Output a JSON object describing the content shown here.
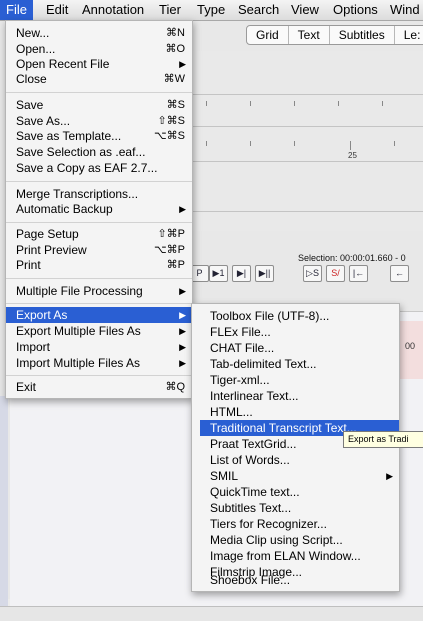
{
  "menubar": {
    "items": [
      "File",
      "Edit",
      "Annotation",
      "Tier",
      "Type",
      "Search",
      "View",
      "Options",
      "Wind"
    ]
  },
  "background": {
    "tabs": [
      "Grid",
      "Text",
      "Subtitles",
      "Le:"
    ],
    "ruler_label": "25",
    "selection_text": "Selection: 00:00:01.660 - 0",
    "time_text": "00",
    "player_buttons": [
      "P",
      "▶1",
      "▶|",
      "▶||",
      "▷S",
      "S/",
      "|←",
      "←"
    ]
  },
  "file_menu": {
    "items": [
      {
        "label": "New...",
        "shortcut": "⌘N"
      },
      {
        "label": "Open...",
        "shortcut": "⌘O"
      },
      {
        "label": "Open Recent File",
        "submenu": true
      },
      {
        "label": "Close",
        "shortcut": "⌘W"
      },
      {
        "label": "Save",
        "shortcut": "⌘S"
      },
      {
        "label": "Save As...",
        "shortcut": "⇧⌘S"
      },
      {
        "label": "Save as Template...",
        "shortcut": "⌥⌘S"
      },
      {
        "label": "Save Selection as .eaf..."
      },
      {
        "label": "Save a Copy as EAF 2.7..."
      },
      {
        "label": "Merge Transcriptions..."
      },
      {
        "label": "Automatic Backup",
        "submenu": true
      },
      {
        "label": "Page Setup",
        "shortcut": "⇧⌘P"
      },
      {
        "label": "Print Preview",
        "shortcut": "⌥⌘P"
      },
      {
        "label": "Print",
        "shortcut": "⌘P"
      },
      {
        "label": "Multiple File Processing",
        "submenu": true
      },
      {
        "label": "Export As",
        "submenu": true,
        "highlighted": true
      },
      {
        "label": "Export Multiple Files As",
        "submenu": true
      },
      {
        "label": "Import",
        "submenu": true
      },
      {
        "label": "Import Multiple Files As",
        "submenu": true
      },
      {
        "label": "Exit",
        "shortcut": "⌘Q"
      }
    ]
  },
  "export_submenu": {
    "items": [
      {
        "label": "Toolbox File (UTF-8)..."
      },
      {
        "label": "FLEx File..."
      },
      {
        "label": "CHAT File..."
      },
      {
        "label": "Tab-delimited Text..."
      },
      {
        "label": "Tiger-xml..."
      },
      {
        "label": "Interlinear Text..."
      },
      {
        "label": "HTML..."
      },
      {
        "label": "Traditional Transcript Text...",
        "highlighted": true
      },
      {
        "label": "Praat TextGrid..."
      },
      {
        "label": "List of Words..."
      },
      {
        "label": "SMIL",
        "submenu": true
      },
      {
        "label": "QuickTime text..."
      },
      {
        "label": "Subtitles Text..."
      },
      {
        "label": "Tiers for Recognizer..."
      },
      {
        "label": "Media Clip using Script..."
      },
      {
        "label": "Image from ELAN Window..."
      },
      {
        "label": "Filmstrip Image..."
      },
      {
        "label": "Shoebox File..."
      }
    ]
  },
  "tooltip": {
    "text": "Export as Tradi"
  },
  "colors": {
    "highlight": "#2a5fd3",
    "menu_bg": "#f4f4f4",
    "tooltip_bg": "#ffffe1"
  }
}
